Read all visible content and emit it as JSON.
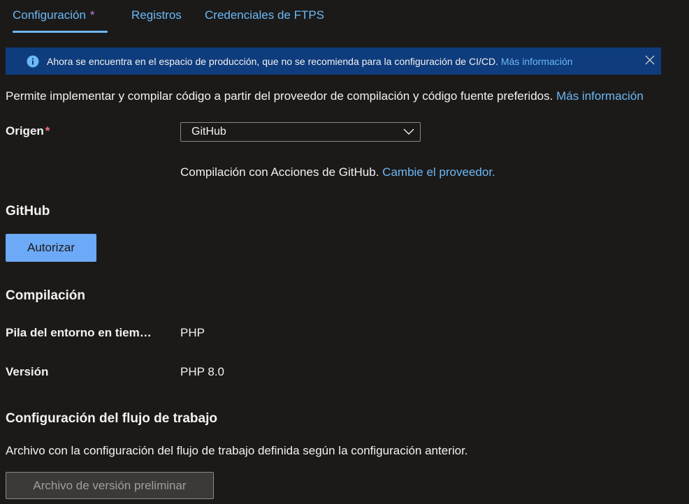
{
  "tabs": [
    {
      "label": "Configuración",
      "modified_marker": "*"
    },
    {
      "label": "Registros"
    },
    {
      "label": "Credenciales de FTPS"
    }
  ],
  "banner": {
    "message": "Ahora se encuentra en el espacio de producción, que no se recomienda para la configuración de CI/CD.",
    "link": "Más información",
    "icon": "info-icon",
    "close_icon": "close-icon",
    "background": "#0e3c7c"
  },
  "intro": {
    "text": "Permite implementar y compilar código a partir del proveedor de compilación y código fuente preferidos.",
    "link": "Más información"
  },
  "source": {
    "label": "Origen",
    "required_marker": "*",
    "value": "GitHub",
    "provider_note": "Compilación con Acciones de GitHub.",
    "provider_link": "Cambie el proveedor."
  },
  "github": {
    "title": "GitHub",
    "authorize_label": "Autorizar"
  },
  "build": {
    "title": "Compilación",
    "stack_label": "Pila del entorno en tiempo de ejecución",
    "stack_value": "PHP",
    "version_label": "Versión",
    "version_value": "PHP 8.0"
  },
  "workflow": {
    "title": "Configuración del flujo de trabajo",
    "description": "Archivo con la configuración del flujo de trabajo definida según la configuración anterior.",
    "preview_label": "Archivo de versión preliminar"
  },
  "colors": {
    "accent": "#6cb8f6",
    "primary_button": "#6ca9f6",
    "required": "#f1707b",
    "modified": "#c87ee8"
  }
}
